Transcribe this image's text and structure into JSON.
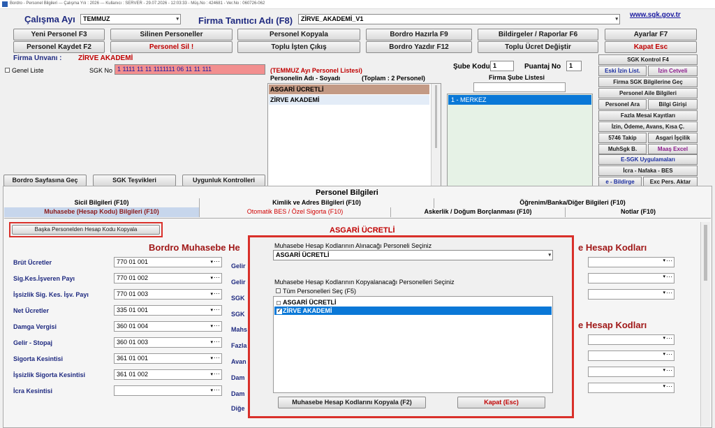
{
  "titlebar": {
    "text": "Bordro - Personel Bilgileri   ---  Çalışma Yılı : 2026   ---   Kullanıcı : SERVER  -  29.07.2026 - 12:03:33   -   Müş.No : 424681  -  Ver.No : 060726-062"
  },
  "header": {
    "period_label": "Çalışma Ayı",
    "period_value": "TEMMUZ",
    "firm_label": "Firma Tanıtıcı Adı (F8)",
    "firm_value": "ZİRVE_AKADEMİ_V1",
    "link": "www.sgk.gov.tr"
  },
  "toolbar1": [
    "Yeni Personel F3",
    "Silinen Personeller",
    "Personel Kopyala",
    "Bordro Hazırla F9",
    "Bildirgeler / Raporlar F6",
    "Ayarlar F7"
  ],
  "toolbar2": [
    "Personel Kaydet F2",
    "Personel Sil !",
    "Toplu İşten Çıkış",
    "Bordro Yazdır F12",
    "Toplu Ücret Değiştir",
    "Kapat Esc"
  ],
  "firm": {
    "unvan_label": "Firma Unvanı :",
    "unvan_value": "ZİRVE AKADEMİ",
    "genel_liste": "Genel Liste",
    "sgk_label": "SGK No",
    "sgk_value": "1 1111 11 11 1111111 06 11 11 111"
  },
  "personnel_list": {
    "title": "(TEMMUZ Ayı Personel Listesi)",
    "col_name": "Personelin Adı - Soyadı",
    "total": "(Toplam : 2 Personel)",
    "items": [
      "ASGARİ ÜCRETLİ",
      "ZİRVE AKADEMİ"
    ]
  },
  "sube": {
    "kodu_label": "Şube Kodu",
    "kodu_value": "1",
    "puantaj_label": "Puantaj No",
    "puantaj_value": "1",
    "list_title": "Firma Şube Listesi",
    "items": [
      "1 - MERKEZ"
    ]
  },
  "side_buttons": {
    "sgk_kontrol": "SGK Kontrol F4",
    "eski_izin": "Eski İzin List.",
    "izin_cetveli": "İzin Cetveli",
    "firma_sgk": "Firma SGK Bilgilerine Geç",
    "aile": "Personel Aile Bilgileri",
    "personel_ara": "Personel Ara",
    "bilgi_girisi": "Bilgi Girişi",
    "fazla_mesai": "Fazla Mesai Kayıtları",
    "izin_odeme": "İzin, Ödeme, Avans, Kısa Ç.",
    "takip5746": "5746 Takip",
    "asgari_iscilik": "Asgari İşçilik",
    "muhsgk": "MuhSgk B.",
    "maas_excel": "Maaş Excel",
    "esgk": "E-SGK Uygulamaları",
    "icra": "İcra - Nafaka - BES",
    "ebildirge": "e - Bildirge",
    "exc_pers": "Exc Pers. Aktar"
  },
  "bottom_buttons": [
    "Bordro Sayfasına Geç",
    "SGK Teşvikleri",
    "Uygunluk Kontrolleri"
  ],
  "section": {
    "title": "Personel Bilgileri",
    "tabs_row1": [
      "Sicil Bilgileri (F10)",
      "Kimlik ve Adres Bilgileri (F10)",
      "Öğrenim/Banka/Diğer Bilgileri (F10)"
    ],
    "tabs_row2": [
      "Muhasebe (Hesap Kodu) Bilgileri (F10)",
      "Otomatik BES / Özel Sigorta (F10)",
      "Askerlik / Doğum Borçlanması (F10)",
      "Notlar (F10)"
    ]
  },
  "content": {
    "copy_btn": "Başka Personelden Hesap Kodu Kopyala",
    "person_name": "ASGARİ ÜCRETLİ",
    "left_title": "Bordro Muhasebe He",
    "right_title1": "e Hesap Kodları",
    "right_title2": "e Hesap Kodları",
    "rows": [
      {
        "label": "Brüt Ücretler",
        "value": "770 01 001"
      },
      {
        "label": "Sig.Kes.İşveren Payı",
        "value": "770 01 002"
      },
      {
        "label": "İşsizlik Sig. Kes. İşv. Payı",
        "value": "770 01 003"
      },
      {
        "label": "Net Ücretler",
        "value": "335 01 001"
      },
      {
        "label": "Damga Vergisi",
        "value": "360 01 004"
      },
      {
        "label": "Gelir - Stopaj",
        "value": "360 01 003"
      },
      {
        "label": "Sigorta Kesintisi",
        "value": "361 01 001"
      },
      {
        "label": "İşsizlik Sigorta Kesintisi",
        "value": "361 01 002"
      },
      {
        "label": "İcra Kesintisi",
        "value": ""
      }
    ],
    "mid_labels": [
      "Gelir",
      "Gelir",
      "SGK",
      "SGK",
      "Mahs",
      "Fazla",
      "Avan",
      "Dam",
      "Dam",
      "Diğe"
    ]
  },
  "dialog": {
    "label1": "Muhasebe Hesap Kodlarının Alınacağı Personeli Seçiniz",
    "source": "ASGARİ ÜCRETLİ",
    "label2": "Muhasebe Hesap Kodlarının Kopyalanacağı Personelleri Seçiniz",
    "select_all": "Tüm Personelleri Seç (F5)",
    "items": [
      "ASGARİ ÜCRETLİ",
      "ZİRVE AKADEMİ"
    ],
    "copy_btn": "Muhasebe Hesap Kodlarını Kopyala (F2)",
    "close_btn": "Kapat (Esc)"
  },
  "colors": {
    "accent_red": "#d9302a",
    "navy": "#1f2a80",
    "selected": "#0a78d7"
  }
}
